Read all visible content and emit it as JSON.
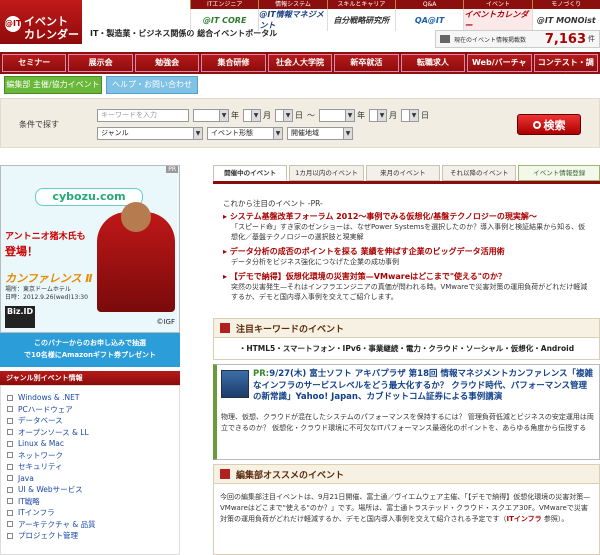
{
  "header": {
    "logo_mark": "@IT",
    "logo_line1": "イベント",
    "logo_line2": "カレンダー",
    "tagline": "IT・製造業・ビジネス関係の 総合イベントポータル",
    "top_nav": [
      "ITエンジニア",
      "情報システム",
      "スキルとキャリア",
      "Q&A",
      "イベント",
      "モノづくり"
    ],
    "sites": [
      "@IT CORE",
      "@IT情報マネジメント",
      "自分戦略研究所",
      "QA@IT",
      "イベントカレンダー",
      "@IT MONOist"
    ],
    "counter": {
      "label": "現在のイベント情報掲載数",
      "value": "7,163",
      "unit": "件"
    }
  },
  "main_nav": [
    "セミナー",
    "展示会",
    "勉強会",
    "集合研修",
    "社会人大学院",
    "新卒就活",
    "転職求人",
    "Web/バーチャル",
    "コンテスト・調査"
  ],
  "sub_nav": [
    "編集部 主催/協力イベント",
    "ヘルプ・お問い合わせ"
  ],
  "search": {
    "label": "条件で探す",
    "keyword_placeholder": "キーワードを入力",
    "year_label": "年",
    "month_label": "月",
    "day_label": "日",
    "range_sep": "〜",
    "genre": "ジャンル",
    "form": "イベント形態",
    "region": "開催地域",
    "button": "検索"
  },
  "banner": {
    "pr": "PR",
    "brand": "cybozu.com",
    "line1": "アントニオ猪木氏も",
    "line2": "登場！",
    "conf": "カンファレンス Ⅱ",
    "place": "場所：東京ドームホテル",
    "date": "日時：2012.9.26(wed)13:30",
    "media": "Biz.ID",
    "credit": "©IGF"
  },
  "promo": {
    "line1": "このバナーからのお申し込みで抽選",
    "line2": "で10名様にAmazonギフト券プレゼント"
  },
  "genre": {
    "header": "ジャンル別イベント情報",
    "items": [
      "Windows & .NET",
      "PCハードウェア",
      "データベース",
      "オープンソース & LL",
      "Linux & Mac",
      "ネットワーク",
      "セキュリティ",
      "Java",
      "UI & Webサービス",
      "IT戦略",
      "ITインフラ",
      "アーキテクチャ & 品質",
      "プロジェクト管理"
    ]
  },
  "tabs": [
    "開催中のイベント",
    "1カ月以内のイベント",
    "来月のイベント",
    "それ以降のイベント",
    "イベント情報登録"
  ],
  "pr_box": {
    "head": "これから注目のイベント -PR-",
    "items": [
      {
        "title": "システム基盤改革フォーラム 2012〜事例でみる仮想化/基盤テクノロジーの現実解〜",
        "desc": "「スピード命」すき家のゼンショーは、なぜPower Systemsを選択したのか？導入事例と検証結果から知る、仮想化／基盤テクノロジーの選択肢と現実解"
      },
      {
        "title": "データ分析の成否のポイントを探る 業績を伸ばす企業のビッグデータ活用術",
        "desc": "データ分析をビジネス強化につなげた企業の成功事例"
      },
      {
        "title": "【デモで納得】仮想化環境の災害対策—VMwareはどこまで\"使える\"のか？",
        "desc": "突然の災害発生—それはインフラエンジニアの真価が問われる時。VMwareで災害対策の運用負荷がどれだけ軽減するか、デモと国内導入事例を交えてご紹介します。"
      }
    ]
  },
  "keywords": {
    "head": "注目キーワードのイベント",
    "text": "・HTML5・スマートフォン・IPv6・事業継続・電力・クラウド・ソーシャル・仮想化・Android"
  },
  "feature": {
    "pr": "PR:",
    "title": "9/27(木) 富士ソフト アキバプラザ 第18回 情報マネジメントカンファレンス「複雑なインフラのサービスレベルをどう最大化するか？ クラウド時代、パフォーマンス管理の新常識」Yahoo! Japan、カブドットコム証券による事例講演",
    "desc": "物理、仮想、クラウドが混在したシステムのパフォーマンスを保持するには？ 管理負荷低減とビジネスの安定運用は両立できるのか？ 仮想化・クラウド環境に不可欠なITパフォーマンス最適化のポイントを、あらゆる角度から伝授する"
  },
  "editor": {
    "head": "編集部オススメのイベント",
    "text": "今回の編集部注目イベントは、9月21日開催、富士通／ヴイエムウェア主催、「【デモで納得】仮想化環境の災害対策—VMwareはどこまで\"使える\"のか？」です。場所は、富士通トラステッド・クラウド・スクエア30F。VMwareで災害対策の運用負荷がどれだけ軽減するか、デモと国内導入事例を交えて紹介される予定です（",
    "keyword": "ITインフラ",
    "tail": " 参照）。"
  }
}
